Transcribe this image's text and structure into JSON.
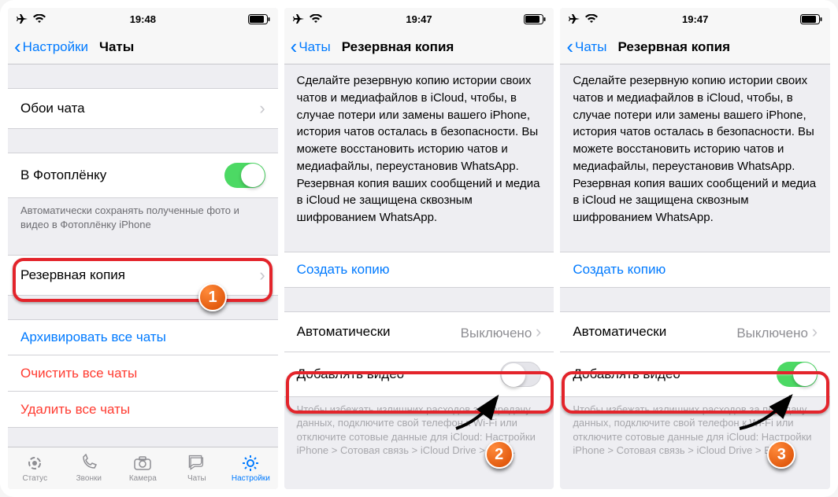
{
  "statusbar": {
    "time1": "19:48",
    "time2": "19:47",
    "time3": "19:47"
  },
  "screen1": {
    "back": "Настройки",
    "title": "Чаты",
    "wallpaper": "Обои чата",
    "camera_roll": "В Фотоплёнку",
    "camera_roll_note": "Автоматически сохранять полученные фото и видео в Фотоплёнку iPhone",
    "backup": "Резервная копия",
    "archive": "Архивировать все чаты",
    "clear": "Очистить все чаты",
    "delete": "Удалить все чаты"
  },
  "screen23": {
    "back": "Чаты",
    "title": "Резервная копия",
    "desc": "Сделайте резервную копию истории своих чатов и медиафайлов в iCloud, чтобы, в случае потери или замены вашего iPhone, история чатов осталась в безопасности. Вы можете восстановить историю чатов и медиафайлы, переустановив WhatsApp. Резервная копия ваших сообщений и медиа в iCloud не защищена сквозным шифрованием WhatsApp.",
    "create": "Создать копию",
    "auto_label": "Автоматически",
    "auto_value": "Выключено",
    "include_video": "Добавлять видео",
    "footer": "Чтобы избежать излишних расходов за передачу данных, подключите свой телефон к Wi-Fi или отключите сотовые данные для iCloud: Настройки iPhone > Сотовая связь > iCloud Drive > Выкл."
  },
  "tabs": {
    "status": "Статус",
    "calls": "Звонки",
    "camera": "Камера",
    "chats": "Чаты",
    "settings": "Настройки"
  },
  "badges": {
    "b1": "1",
    "b2": "2",
    "b3": "3"
  }
}
